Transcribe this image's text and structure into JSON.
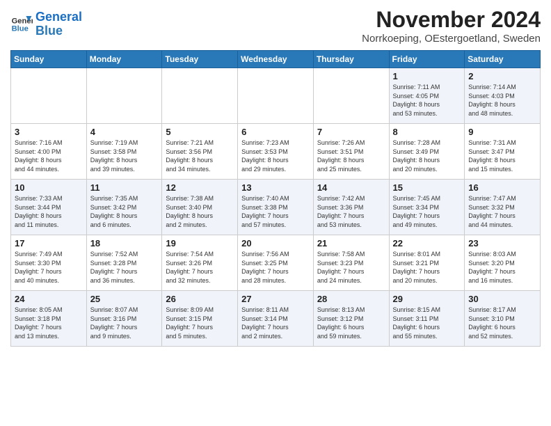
{
  "header": {
    "logo_line1": "General",
    "logo_line2": "Blue",
    "title": "November 2024",
    "location": "Norrkoeping, OEstergoetland, Sweden"
  },
  "weekdays": [
    "Sunday",
    "Monday",
    "Tuesday",
    "Wednesday",
    "Thursday",
    "Friday",
    "Saturday"
  ],
  "weeks": [
    [
      {
        "day": "",
        "info": ""
      },
      {
        "day": "",
        "info": ""
      },
      {
        "day": "",
        "info": ""
      },
      {
        "day": "",
        "info": ""
      },
      {
        "day": "",
        "info": ""
      },
      {
        "day": "1",
        "info": "Sunrise: 7:11 AM\nSunset: 4:05 PM\nDaylight: 8 hours\nand 53 minutes."
      },
      {
        "day": "2",
        "info": "Sunrise: 7:14 AM\nSunset: 4:03 PM\nDaylight: 8 hours\nand 48 minutes."
      }
    ],
    [
      {
        "day": "3",
        "info": "Sunrise: 7:16 AM\nSunset: 4:00 PM\nDaylight: 8 hours\nand 44 minutes."
      },
      {
        "day": "4",
        "info": "Sunrise: 7:19 AM\nSunset: 3:58 PM\nDaylight: 8 hours\nand 39 minutes."
      },
      {
        "day": "5",
        "info": "Sunrise: 7:21 AM\nSunset: 3:56 PM\nDaylight: 8 hours\nand 34 minutes."
      },
      {
        "day": "6",
        "info": "Sunrise: 7:23 AM\nSunset: 3:53 PM\nDaylight: 8 hours\nand 29 minutes."
      },
      {
        "day": "7",
        "info": "Sunrise: 7:26 AM\nSunset: 3:51 PM\nDaylight: 8 hours\nand 25 minutes."
      },
      {
        "day": "8",
        "info": "Sunrise: 7:28 AM\nSunset: 3:49 PM\nDaylight: 8 hours\nand 20 minutes."
      },
      {
        "day": "9",
        "info": "Sunrise: 7:31 AM\nSunset: 3:47 PM\nDaylight: 8 hours\nand 15 minutes."
      }
    ],
    [
      {
        "day": "10",
        "info": "Sunrise: 7:33 AM\nSunset: 3:44 PM\nDaylight: 8 hours\nand 11 minutes."
      },
      {
        "day": "11",
        "info": "Sunrise: 7:35 AM\nSunset: 3:42 PM\nDaylight: 8 hours\nand 6 minutes."
      },
      {
        "day": "12",
        "info": "Sunrise: 7:38 AM\nSunset: 3:40 PM\nDaylight: 8 hours\nand 2 minutes."
      },
      {
        "day": "13",
        "info": "Sunrise: 7:40 AM\nSunset: 3:38 PM\nDaylight: 7 hours\nand 57 minutes."
      },
      {
        "day": "14",
        "info": "Sunrise: 7:42 AM\nSunset: 3:36 PM\nDaylight: 7 hours\nand 53 minutes."
      },
      {
        "day": "15",
        "info": "Sunrise: 7:45 AM\nSunset: 3:34 PM\nDaylight: 7 hours\nand 49 minutes."
      },
      {
        "day": "16",
        "info": "Sunrise: 7:47 AM\nSunset: 3:32 PM\nDaylight: 7 hours\nand 44 minutes."
      }
    ],
    [
      {
        "day": "17",
        "info": "Sunrise: 7:49 AM\nSunset: 3:30 PM\nDaylight: 7 hours\nand 40 minutes."
      },
      {
        "day": "18",
        "info": "Sunrise: 7:52 AM\nSunset: 3:28 PM\nDaylight: 7 hours\nand 36 minutes."
      },
      {
        "day": "19",
        "info": "Sunrise: 7:54 AM\nSunset: 3:26 PM\nDaylight: 7 hours\nand 32 minutes."
      },
      {
        "day": "20",
        "info": "Sunrise: 7:56 AM\nSunset: 3:25 PM\nDaylight: 7 hours\nand 28 minutes."
      },
      {
        "day": "21",
        "info": "Sunrise: 7:58 AM\nSunset: 3:23 PM\nDaylight: 7 hours\nand 24 minutes."
      },
      {
        "day": "22",
        "info": "Sunrise: 8:01 AM\nSunset: 3:21 PM\nDaylight: 7 hours\nand 20 minutes."
      },
      {
        "day": "23",
        "info": "Sunrise: 8:03 AM\nSunset: 3:20 PM\nDaylight: 7 hours\nand 16 minutes."
      }
    ],
    [
      {
        "day": "24",
        "info": "Sunrise: 8:05 AM\nSunset: 3:18 PM\nDaylight: 7 hours\nand 13 minutes."
      },
      {
        "day": "25",
        "info": "Sunrise: 8:07 AM\nSunset: 3:16 PM\nDaylight: 7 hours\nand 9 minutes."
      },
      {
        "day": "26",
        "info": "Sunrise: 8:09 AM\nSunset: 3:15 PM\nDaylight: 7 hours\nand 5 minutes."
      },
      {
        "day": "27",
        "info": "Sunrise: 8:11 AM\nSunset: 3:14 PM\nDaylight: 7 hours\nand 2 minutes."
      },
      {
        "day": "28",
        "info": "Sunrise: 8:13 AM\nSunset: 3:12 PM\nDaylight: 6 hours\nand 59 minutes."
      },
      {
        "day": "29",
        "info": "Sunrise: 8:15 AM\nSunset: 3:11 PM\nDaylight: 6 hours\nand 55 minutes."
      },
      {
        "day": "30",
        "info": "Sunrise: 8:17 AM\nSunset: 3:10 PM\nDaylight: 6 hours\nand 52 minutes."
      }
    ]
  ]
}
